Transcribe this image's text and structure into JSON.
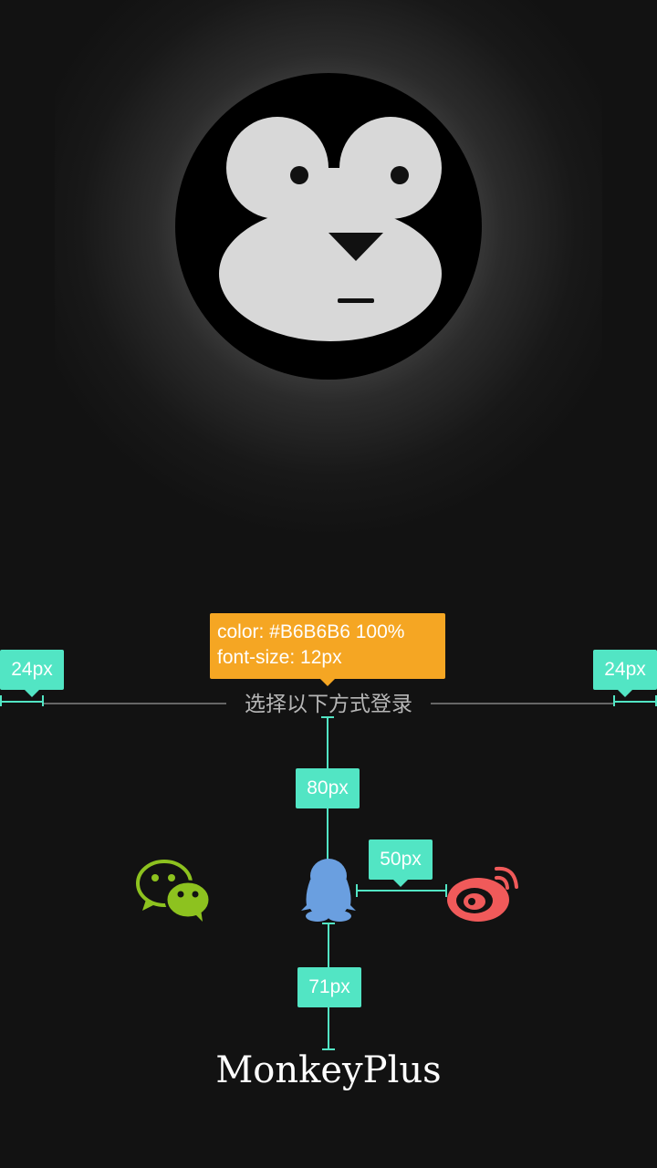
{
  "app": {
    "name": "MonkeyPlus"
  },
  "login": {
    "prompt": "选择以下方式登录",
    "text_color": "#B6B6B6",
    "options": [
      {
        "id": "wechat",
        "icon": "wechat-icon",
        "color": "#8DC21F"
      },
      {
        "id": "qq",
        "icon": "qq-penguin-icon",
        "color": "#6A9FE0"
      },
      {
        "id": "weibo",
        "icon": "weibo-icon",
        "color": "#F05A5A"
      }
    ]
  },
  "annotations": {
    "style_note": {
      "line1": "color: #B6B6B6 100%",
      "line2": "font-size: 12px"
    },
    "left_margin": "24px",
    "right_margin": "24px",
    "label_to_icons": "80px",
    "icon_gap": "50px",
    "icons_to_brand": "71px",
    "accent_color": "#52E5C4",
    "note_color": "#F5A623"
  },
  "logo": {
    "icon": "monkey-face-icon"
  }
}
